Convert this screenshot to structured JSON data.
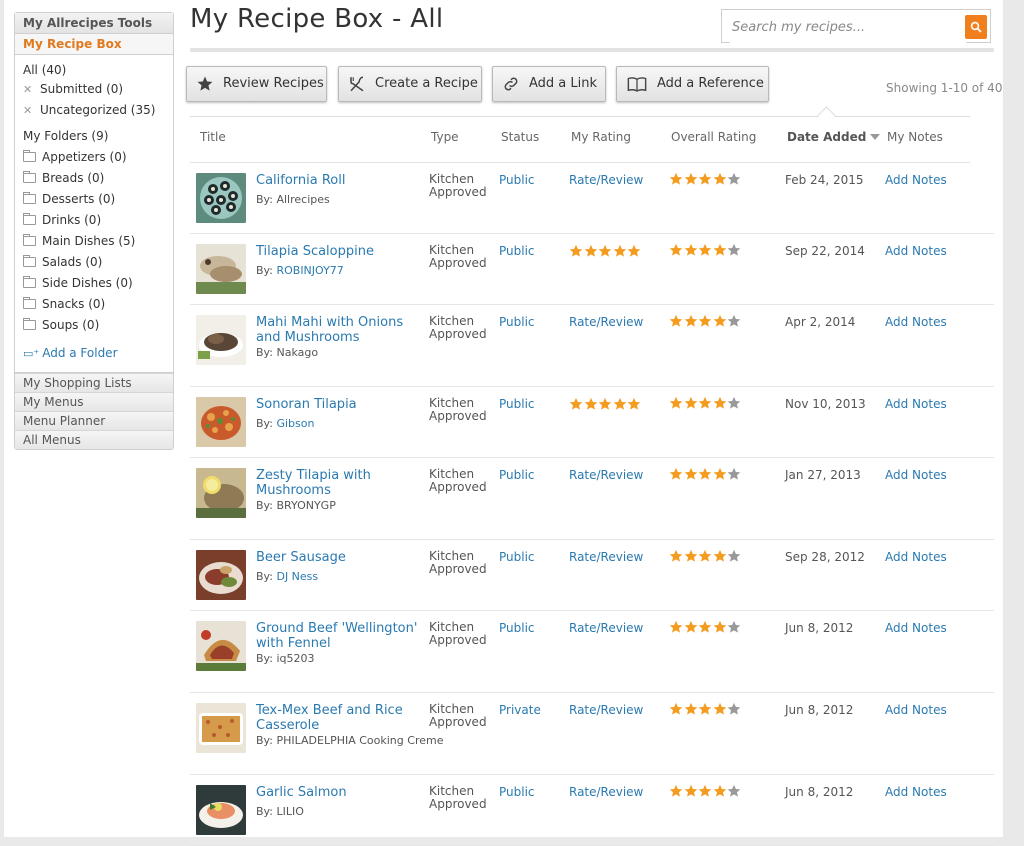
{
  "sidebar": {
    "tools_label": "My Allrecipes Tools",
    "recipe_box_label": "My Recipe Box",
    "all": "All (40)",
    "submitted": "Submitted (0)",
    "uncategorized": "Uncategorized (35)",
    "folders_head": "My Folders (9)",
    "folders": [
      "Appetizers (0)",
      "Breads (0)",
      "Desserts (0)",
      "Drinks (0)",
      "Main Dishes (5)",
      "Salads (0)",
      "Side Dishes (0)",
      "Snacks (0)",
      "Soups (0)"
    ],
    "add_folder": "Add a Folder",
    "links": [
      "My Shopping Lists",
      "My Menus",
      "Menu Planner",
      "All Menus"
    ]
  },
  "header": {
    "title": "My Recipe Box - All",
    "search_placeholder": "Search my recipes..."
  },
  "toolbar": {
    "review": "Review Recipes",
    "create": "Create a Recipe",
    "link": "Add a Link",
    "reference": "Add a Reference",
    "showing": "Showing 1-10 of 40"
  },
  "columns": {
    "title": "Title",
    "type": "Type",
    "status": "Status",
    "my_rating": "My Rating",
    "overall": "Overall Rating",
    "date": "Date Added",
    "notes": "My Notes"
  },
  "colors": {
    "accent": "#f07f1e",
    "link": "#2a7ab0",
    "star": "#f39c1f",
    "star_empty": "#999999"
  },
  "rows": [
    {
      "title": "California Roll",
      "by": "By:",
      "author": "Allrecipes",
      "author_link": false,
      "type1": "Kitchen",
      "type2": "Approved",
      "status": "Public",
      "my_rating_text": "Rate/Review",
      "my_rating_stars": 0,
      "overall": 4,
      "date": "Feb 24, 2015",
      "notes": "Add Notes",
      "thumb": "california-roll"
    },
    {
      "title": "Tilapia Scaloppine",
      "by": "By:",
      "author": "ROBINJOY77",
      "author_link": true,
      "type1": "Kitchen",
      "type2": "Approved",
      "status": "Public",
      "my_rating_text": "",
      "my_rating_stars": 5,
      "overall": 4,
      "date": "Sep 22, 2014",
      "notes": "Add Notes",
      "thumb": "tilapia-scaloppine"
    },
    {
      "title": "Mahi Mahi with Onions and Mushrooms",
      "by": "By:",
      "author": "Nakago",
      "author_link": false,
      "type1": "Kitchen",
      "type2": "Approved",
      "status": "Public",
      "my_rating_text": "Rate/Review",
      "my_rating_stars": 0,
      "overall": 4,
      "date": "Apr 2, 2014",
      "notes": "Add Notes",
      "thumb": "mahi-mahi"
    },
    {
      "title": "Sonoran Tilapia",
      "by": "By:",
      "author": "Gibson",
      "author_link": true,
      "type1": "Kitchen",
      "type2": "Approved",
      "status": "Public",
      "my_rating_text": "",
      "my_rating_stars": 5,
      "overall": 4,
      "date": "Nov 10, 2013",
      "notes": "Add Notes",
      "thumb": "sonoran-tilapia"
    },
    {
      "title": "Zesty Tilapia with Mushrooms",
      "by": "By:",
      "author": "BRYONYGP",
      "author_link": false,
      "type1": "Kitchen",
      "type2": "Approved",
      "status": "Public",
      "my_rating_text": "Rate/Review",
      "my_rating_stars": 0,
      "overall": 4,
      "date": "Jan 27, 2013",
      "notes": "Add Notes",
      "thumb": "zesty-tilapia"
    },
    {
      "title": "Beer Sausage",
      "by": "By:",
      "author": "DJ Ness",
      "author_link": true,
      "type1": "Kitchen",
      "type2": "Approved",
      "status": "Public",
      "my_rating_text": "Rate/Review",
      "my_rating_stars": 0,
      "overall": 4,
      "date": "Sep 28, 2012",
      "notes": "Add Notes",
      "thumb": "beer-sausage"
    },
    {
      "title": "Ground Beef 'Wellington' with Fennel",
      "by": "By:",
      "author": "iq5203",
      "author_link": false,
      "type1": "Kitchen",
      "type2": "Approved",
      "status": "Public",
      "my_rating_text": "Rate/Review",
      "my_rating_stars": 0,
      "overall": 4,
      "date": "Jun 8, 2012",
      "notes": "Add Notes",
      "thumb": "beef-wellington"
    },
    {
      "title": "Tex-Mex Beef and Rice Casserole",
      "by": "By:",
      "author": "PHILADELPHIA Cooking Creme",
      "author_link": false,
      "type1": "Kitchen",
      "type2": "Approved",
      "status": "Private",
      "my_rating_text": "Rate/Review",
      "my_rating_stars": 0,
      "overall": 4,
      "date": "Jun 8, 2012",
      "notes": "Add Notes",
      "thumb": "tex-mex-casserole"
    },
    {
      "title": "Garlic Salmon",
      "by": "By:",
      "author": "LILIO",
      "author_link": false,
      "type1": "Kitchen",
      "type2": "Approved",
      "status": "Public",
      "my_rating_text": "Rate/Review",
      "my_rating_stars": 0,
      "overall": 4,
      "date": "Jun 8, 2012",
      "notes": "Add Notes",
      "thumb": "garlic-salmon"
    }
  ]
}
